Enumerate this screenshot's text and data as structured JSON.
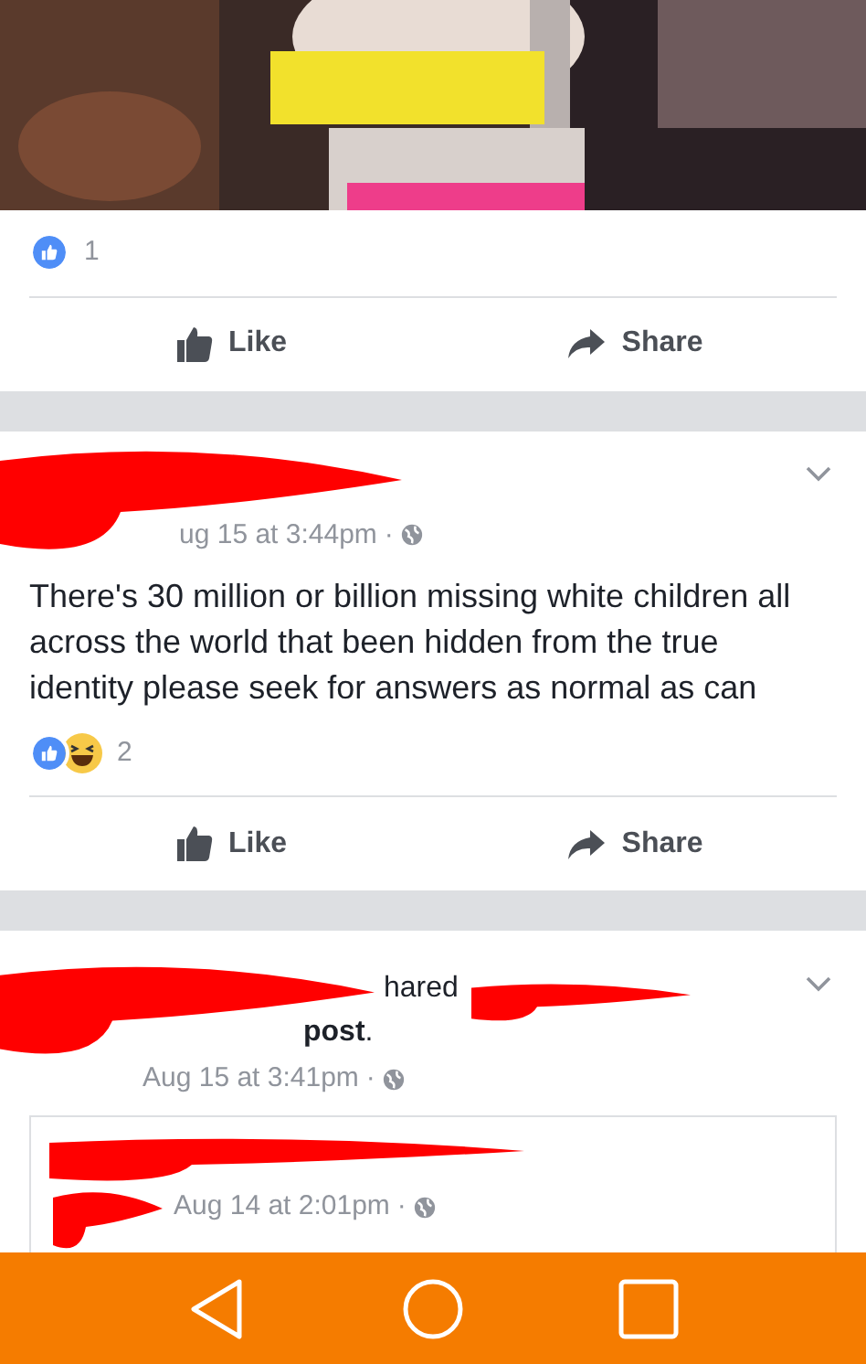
{
  "posts": [
    {
      "reactions": {
        "types": [
          {
            "kind": "like"
          }
        ],
        "count": "1"
      },
      "actions": [
        {
          "kind": "like",
          "label": "Like"
        },
        {
          "kind": "share",
          "label": "Share"
        }
      ]
    },
    {
      "kind": "status",
      "timestamp": "ug 15 at 3:44pm",
      "separator": "·",
      "text": "There's 30 million or billion missing white children all across the world that been hidden from the true identity please seek for answers as normal as can",
      "reactions": {
        "types": [
          {
            "kind": "like"
          },
          {
            "kind": "haha"
          }
        ],
        "count": "2"
      },
      "actions": [
        {
          "kind": "like",
          "label": "Like"
        },
        {
          "kind": "share",
          "label": "Share"
        }
      ]
    },
    {
      "kind": "shared",
      "header_fragments": [
        "hared",
        "**post**."
      ],
      "timestamp": "Aug 15 at 3:41pm",
      "separator": "·",
      "embedded": {
        "timestamp": "Aug 14 at 2:01pm",
        "separator": "·"
      }
    }
  ],
  "nav_buttons": [
    {
      "kind": "back"
    },
    {
      "kind": "home"
    },
    {
      "kind": "recents"
    }
  ]
}
